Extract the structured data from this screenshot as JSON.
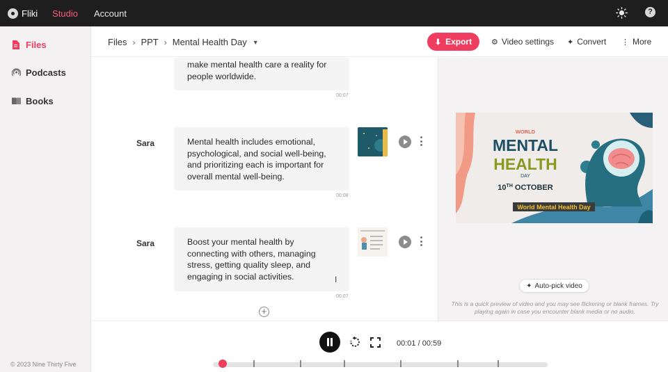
{
  "topbar": {
    "brand": "Fliki",
    "nav": [
      "Studio",
      "Account"
    ],
    "theme_icon": "sun-icon",
    "help_icon": "question-circle-icon",
    "help_glyph": "?"
  },
  "sidebar": {
    "items": [
      {
        "label": "Files",
        "icon": "file-icon",
        "active": true
      },
      {
        "label": "Podcasts",
        "icon": "podcast-icon",
        "active": false
      },
      {
        "label": "Books",
        "icon": "book-icon",
        "active": false
      }
    ],
    "copyright": "© 2023 Nine Thirty Five"
  },
  "header": {
    "breadcrumb": [
      "Files",
      "PPT",
      "Mental Health Day"
    ],
    "export_label": "Export",
    "video_settings_label": "Video settings",
    "convert_label": "Convert",
    "more_label": "More"
  },
  "editor": {
    "blocks": [
      {
        "speaker": "",
        "text": "make mental health care a reality for people worldwide.",
        "duration": "00:07"
      },
      {
        "speaker": "Sara",
        "text": "Mental health includes emotional, psychological, and social well-being, and prioritizing each is important for overall mental well-being.",
        "duration": "00:08"
      },
      {
        "speaker": "Sara",
        "text": "Boost your mental health by connecting with others, managing stress, getting quality sleep, and engaging in social activities.",
        "duration": "00:07"
      }
    ]
  },
  "preview": {
    "slide": {
      "kicker": "WORLD",
      "line1": "MENTAL",
      "line2": "HEALTH",
      "line3": "DAY",
      "date_day": "10",
      "date_sup": "TH",
      "date_month": "OCTOBER",
      "banner": "World Mental Health Day"
    },
    "autopick_label": "Auto-pick video",
    "note": "This is a quick preview of video and you may see flickering or blank frames. Try playing again in case you encounter blank media or no audio."
  },
  "player": {
    "timecode": "00:01 / 00:59",
    "progress": 0.02,
    "markers": [
      0.12,
      0.26,
      0.39,
      0.56,
      0.73,
      0.85
    ]
  },
  "colors": {
    "accent": "#ee3d5e",
    "topbar": "#1e1e1e",
    "sidebar": "#f3f1f1",
    "slide_title": "#1d4f66",
    "slide_health": "#8a9a1f"
  }
}
